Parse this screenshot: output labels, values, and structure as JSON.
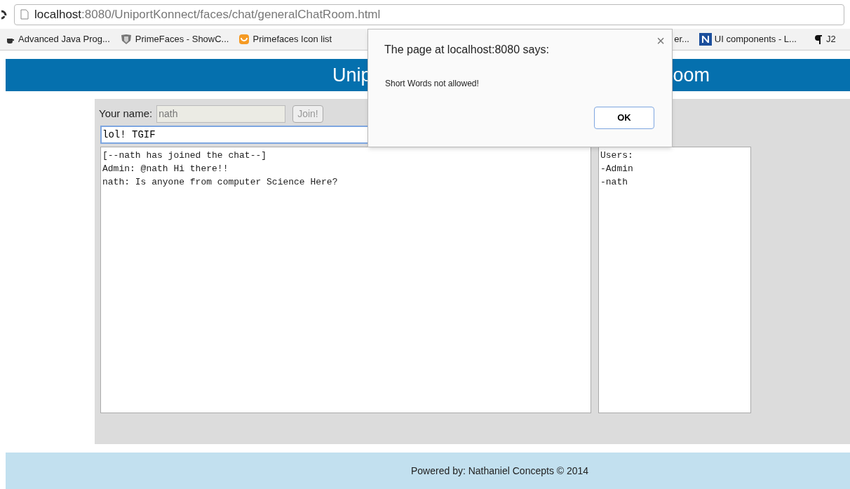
{
  "browser": {
    "url_host": "localhost",
    "url_path": ":8080/UniportKonnect/faces/chat/generalChatRoom.html",
    "bookmarks": [
      {
        "label": "Advanced Java Prog...",
        "kind": "java"
      },
      {
        "label": "PrimeFaces - ShowC...",
        "kind": "shield"
      },
      {
        "label": "Primefaces Icon list",
        "kind": "cup"
      },
      {
        "label": "er...",
        "kind": "none"
      },
      {
        "label": "UI components - L...",
        "kind": "n"
      },
      {
        "label": "J2",
        "kind": "pilcrow"
      }
    ]
  },
  "banner": {
    "title_left": "Unip",
    "title_right": "oom"
  },
  "join_form": {
    "label": "Your name:",
    "name_value": "nath",
    "name_disabled": true,
    "join_button": "Join!",
    "join_disabled": true
  },
  "message_field": {
    "value": "lol! TGIF"
  },
  "chat_log": [
    "[--nath has joined the chat--]",
    "Admin: @nath Hi there!!",
    "nath: Is anyone from computer Science Here?"
  ],
  "users_list": [
    "Users:",
    "-Admin",
    "-nath"
  ],
  "dialog": {
    "title": "The page at localhost:8080 says:",
    "message": "Short Words not allowed!",
    "ok_button": "OK",
    "close": "×"
  },
  "footer": {
    "text": "Powered by: Nathaniel Concepts © 2014"
  }
}
